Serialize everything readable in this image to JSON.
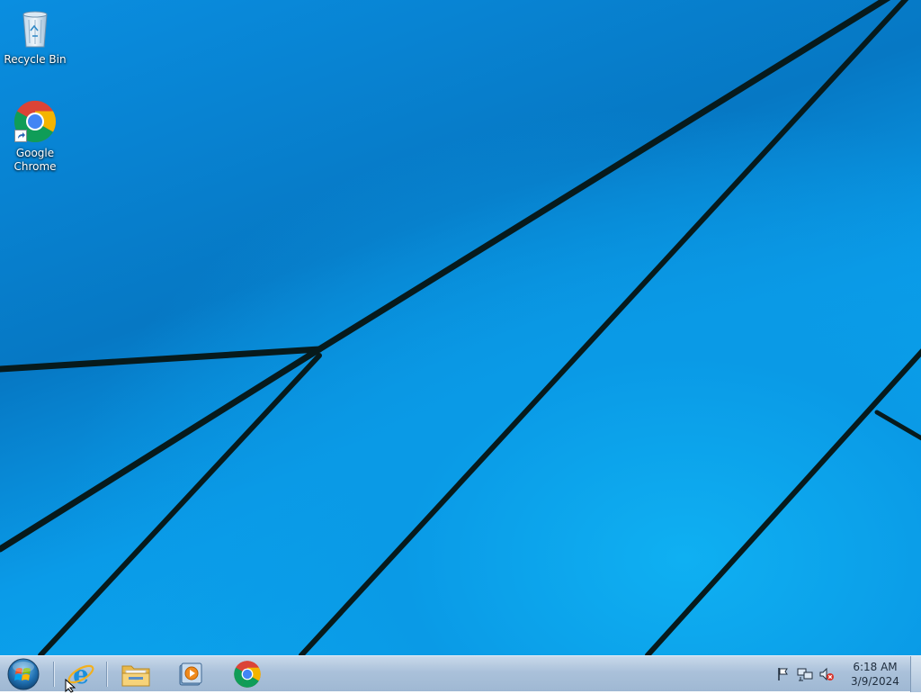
{
  "desktop": {
    "icons": [
      {
        "label": "Recycle Bin",
        "icon": "recycle-bin-icon"
      },
      {
        "label_line1": "Google",
        "label_line2": "Chrome",
        "icon": "chrome-icon",
        "shortcut": true
      }
    ]
  },
  "taskbar": {
    "start": {
      "icon": "windows-start-orb-icon"
    },
    "pinned": [
      {
        "name": "Internet Explorer",
        "icon": "internet-explorer-icon"
      },
      {
        "name": "File Explorer",
        "icon": "folder-icon"
      },
      {
        "name": "Windows Media Player",
        "icon": "media-player-icon"
      },
      {
        "name": "Google Chrome",
        "icon": "chrome-icon"
      }
    ],
    "tray": {
      "icons": [
        "action-center-flag-icon",
        "network-icon",
        "volume-muted-icon"
      ],
      "time": "6:18 AM",
      "date": "3/9/2024"
    }
  },
  "colors": {
    "wallpaper_blue": "#0a9be8",
    "wallpaper_lines": "#071a1c",
    "taskbar": "#aac1da"
  }
}
